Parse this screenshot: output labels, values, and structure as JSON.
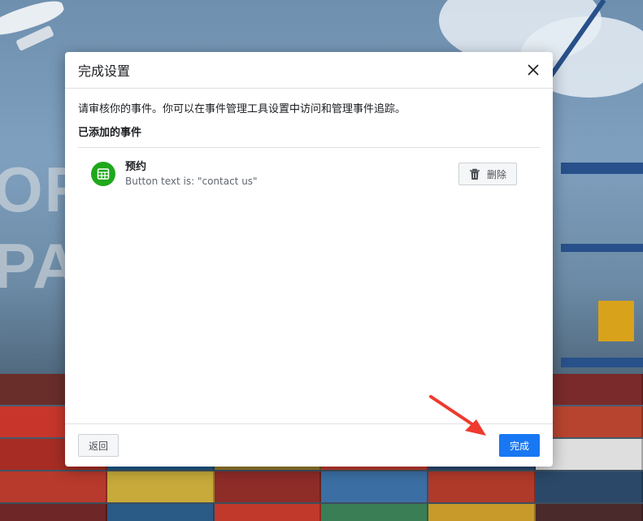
{
  "background": {
    "overlay_text_line1": "ORT",
    "overlay_text_line2": "PA"
  },
  "dialog": {
    "title": "完成设置",
    "intro": "请审核你的事件。你可以在事件管理工具设置中访问和管理事件追踪。",
    "section_title": "已添加的事件",
    "events": [
      {
        "name": "预约",
        "description": "Button text is: \"contact us\"",
        "icon": "calendar-icon",
        "icon_color": "#1fa81b",
        "delete_label": "删除"
      }
    ],
    "back_label": "返回",
    "done_label": "完成"
  },
  "colors": {
    "primary": "#1877f2",
    "arrow": "#ee3a2f"
  }
}
